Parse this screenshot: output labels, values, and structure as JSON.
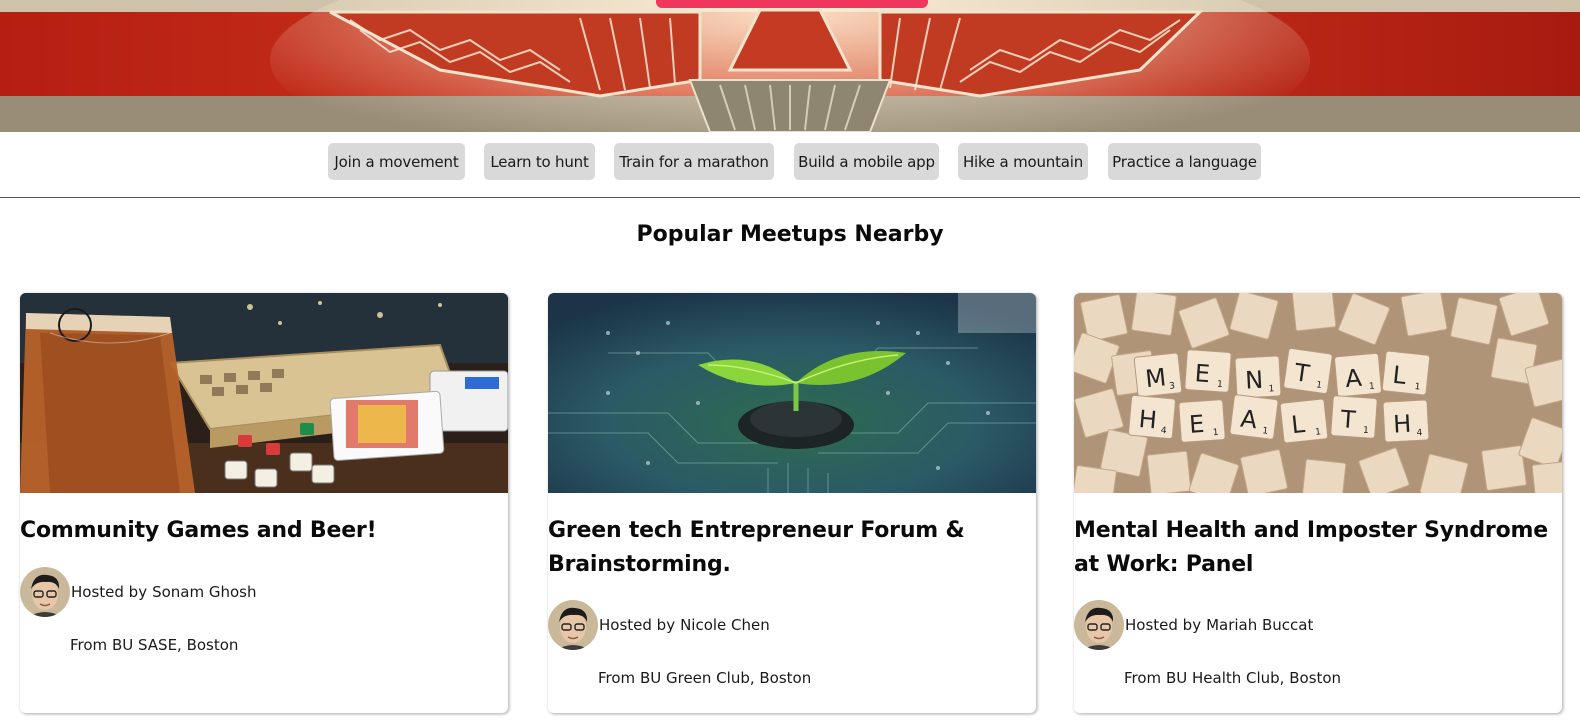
{
  "chips": [
    "Join a movement",
    "Learn to hunt",
    "Train for a marathon",
    "Build a mobile app",
    "Hike a mountain",
    "Practice a language"
  ],
  "section_title": "Popular Meetups Nearby",
  "host_prefix": "Hosted by",
  "from_prefix": "From",
  "cards": [
    {
      "title": "Community Games and Beer!",
      "host": "Sonam Ghosh",
      "from": "BU SASE, Boston",
      "image": "games-and-beer-photo"
    },
    {
      "title": "Green tech Entrepreneur Forum & Brainstorming.",
      "host": "Nicole Chen",
      "from": "BU Green Club, Boston",
      "image": "sprout-on-circuit-board-photo"
    },
    {
      "title": "Mental Health and Imposter Syndrome at Work: Panel",
      "host": "Mariah Buccat",
      "from": "BU Health Club, Boston",
      "image": "scrabble-mental-health-photo"
    }
  ],
  "scrabble_tiles": [
    {
      "letter": "M",
      "sub": "3"
    },
    {
      "letter": "E",
      "sub": "1"
    },
    {
      "letter": "N",
      "sub": "1"
    },
    {
      "letter": "T",
      "sub": "1"
    },
    {
      "letter": "A",
      "sub": "1"
    },
    {
      "letter": "L",
      "sub": "1"
    },
    {
      "letter": "H",
      "sub": "4"
    },
    {
      "letter": "E",
      "sub": "1"
    },
    {
      "letter": "A",
      "sub": "1"
    },
    {
      "letter": "L",
      "sub": "1"
    },
    {
      "letter": "T",
      "sub": "1"
    },
    {
      "letter": "H",
      "sub": "4"
    }
  ],
  "colors": {
    "accent": "#f0365c",
    "chip_bg": "#d9d9d9"
  }
}
